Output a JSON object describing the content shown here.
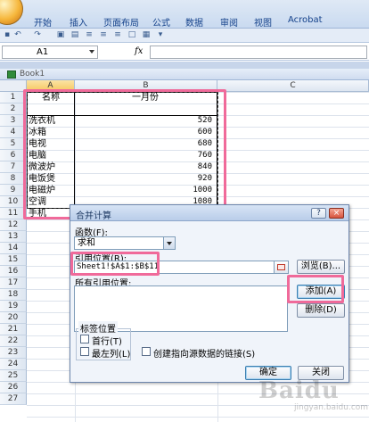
{
  "ribbon": {
    "tabs": [
      "开始",
      "插入",
      "页面布局",
      "公式",
      "数据",
      "审阅",
      "视图",
      "Acrobat"
    ]
  },
  "formula_bar": {
    "name_box": "A1",
    "fx": "fx",
    "value": ""
  },
  "workbook": {
    "title": "Book1"
  },
  "grid": {
    "columns": [
      "A",
      "B",
      "C"
    ],
    "rows": [
      "1",
      "2",
      "3",
      "4",
      "5",
      "6",
      "7",
      "8",
      "9",
      "10",
      "11",
      "12",
      "13",
      "14",
      "15",
      "16",
      "17",
      "18",
      "19",
      "20",
      "21",
      "22",
      "23",
      "24",
      "25",
      "26",
      "27"
    ],
    "header": {
      "a": "名称",
      "b": "一月份"
    },
    "data": [
      {
        "name": "洗衣机",
        "value": "520"
      },
      {
        "name": "冰箱",
        "value": "600"
      },
      {
        "name": "电视",
        "value": "680"
      },
      {
        "name": "电脑",
        "value": "760"
      },
      {
        "name": "微波炉",
        "value": "840"
      },
      {
        "name": "电饭煲",
        "value": "920"
      },
      {
        "name": "电磁炉",
        "value": "1000"
      },
      {
        "name": "空调",
        "value": "1080"
      },
      {
        "name": "手机",
        "value": ""
      }
    ]
  },
  "dialog": {
    "title": "合并计算",
    "help_btn": "?",
    "close_btn": "×",
    "function_label": "函数(F):",
    "function_value": "求和",
    "ref_label": "引用位置(R):",
    "ref_value": "Sheet1!$A$1:$B$11",
    "browse_btn": "浏览(B)...",
    "all_refs_label": "所有引用位置:",
    "add_btn": "添加(A)",
    "delete_btn": "删除(D)",
    "label_pos_label": "标签位置",
    "top_row": "首行(T)",
    "left_col": "最左列(L)",
    "link_source": "创建指向源数据的链接(S)",
    "ok_btn": "确定",
    "close_btn_label": "关闭"
  },
  "watermark": {
    "text": "Baidu",
    "sub": "jingyan.baidu.com"
  },
  "colors": {
    "highlight": "#f06a9a",
    "ribbon_text": "#15428b"
  },
  "icons": [
    "office-button-icon",
    "save-icon",
    "undo-icon",
    "redo-icon",
    "workbook-icon",
    "collapse-ref-icon"
  ]
}
